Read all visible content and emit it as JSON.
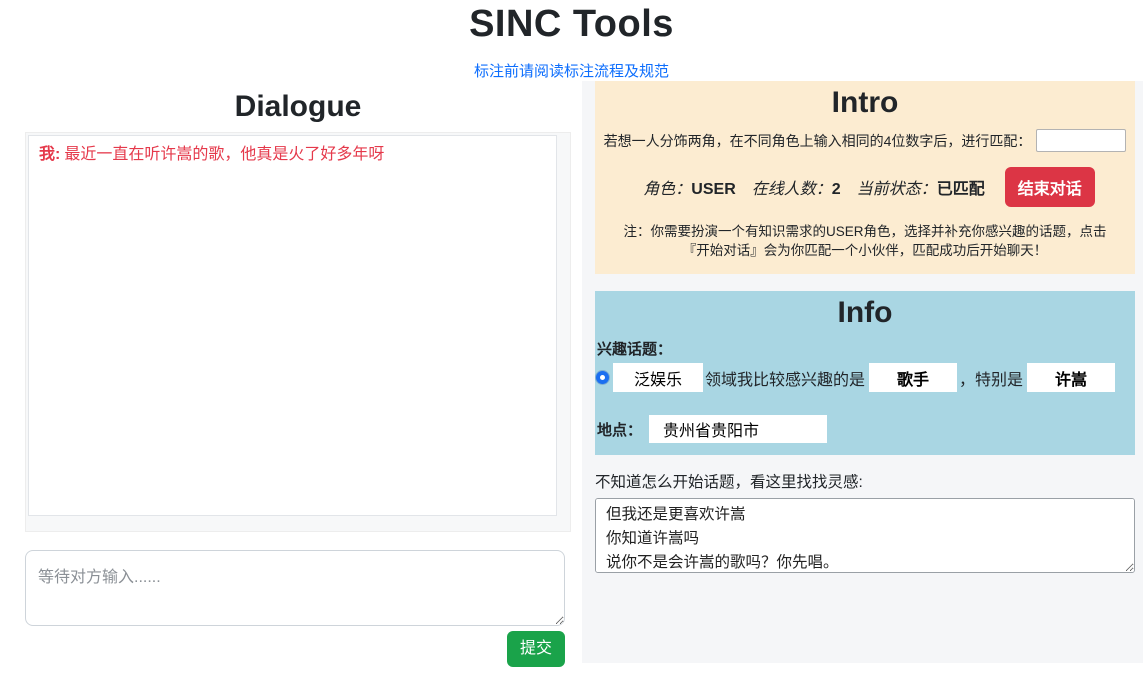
{
  "header": {
    "title": "SINC Tools",
    "guide_link": "标注前请阅读标注流程及规范"
  },
  "dialogue": {
    "title": "Dialogue",
    "messages": [
      {
        "speaker": "我:",
        "text": "最近一直在听许嵩的歌，他真是火了好多年呀"
      }
    ],
    "input_placeholder": "等待对方输入......",
    "input_value": "",
    "submit_label": "提交"
  },
  "intro": {
    "title": "Intro",
    "match_text": "若想一人分饰两角，在不同角色上输入相同的4位数字后，进行匹配：",
    "match_code_value": "",
    "role_label": "角色：",
    "role_value": "USER",
    "online_label": "在线人数：",
    "online_value": "2",
    "status_label": "当前状态：",
    "status_value": "已匹配",
    "end_button_label": "结束对话",
    "note": "注：你需要扮演一个有知识需求的USER角色，选择并补充你感兴趣的话题，点击『开始对话』会为你匹配一个小伙伴，匹配成功后开始聊天！"
  },
  "info": {
    "title": "Info",
    "topic_section_label": "兴趣话题：",
    "topic_domain_value": "泛娱乐",
    "topic_text_1": "领域我比较感兴趣的是",
    "topic_category_value": "歌手",
    "topic_text_2": "，特别是",
    "topic_detail_value": "许嵩",
    "location_label": "地点：",
    "location_value": "贵州省贵阳市"
  },
  "inspiration": {
    "label": "不知道怎么开始话题，看这里找找灵感:",
    "suggestions": "但我还是更喜欢许嵩\n你知道许嵩吗\n说你不是会许嵩的歌吗？你先唱。"
  },
  "colors": {
    "page_bg": "#ffffff",
    "right_col_bg": "#f5f6f8",
    "intro_bg": "#fcecd1",
    "info_bg": "#a9d6e3",
    "danger": "#dc3545",
    "success": "#1aa34a",
    "link": "#0d6efd",
    "message_red": "#e5394b",
    "radio_blue": "#1b6ff0"
  }
}
